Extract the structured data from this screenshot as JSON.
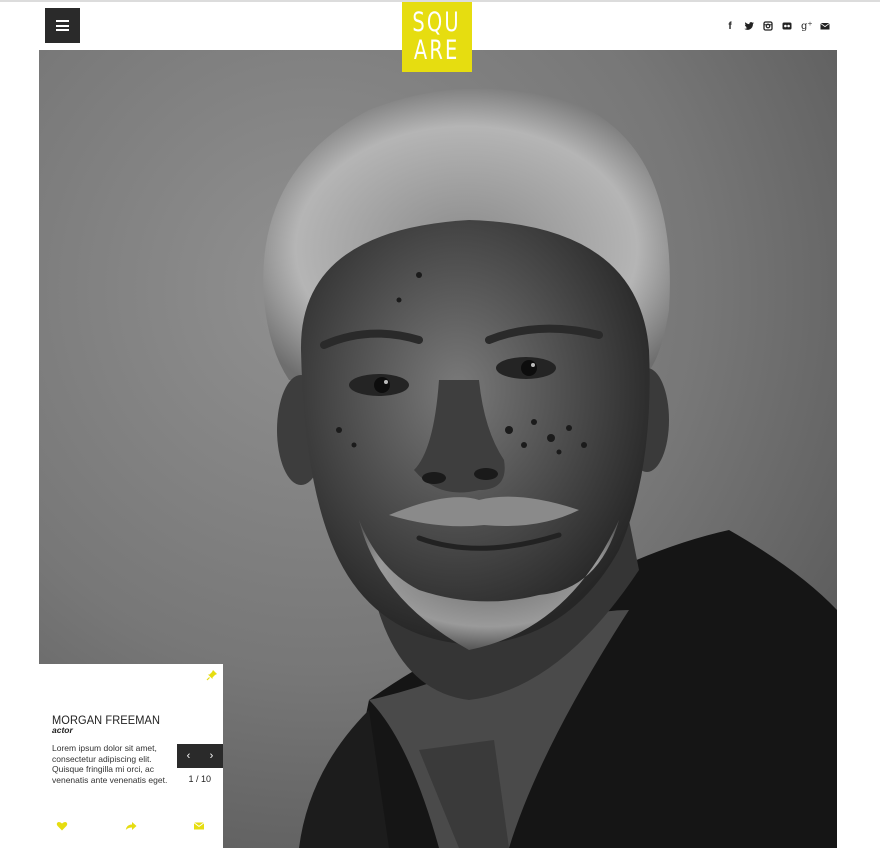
{
  "header": {
    "logo_line1": "SQU",
    "logo_line2": "ARE",
    "menu_icon": "hamburger-menu-icon",
    "social": [
      {
        "icon": "facebook-icon",
        "glyph": "f"
      },
      {
        "icon": "twitter-icon",
        "glyph": "🐦"
      },
      {
        "icon": "instagram-icon",
        "glyph": "◎"
      },
      {
        "icon": "flickr-icon",
        "glyph": "◉"
      },
      {
        "icon": "google-plus-icon",
        "glyph": "g⁺"
      },
      {
        "icon": "email-icon",
        "glyph": "✉"
      }
    ]
  },
  "colors": {
    "accent": "#e6dd10",
    "dark": "#2a2a2a"
  },
  "hero": {
    "image": "black-and-white portrait photograph"
  },
  "info_card": {
    "name": "MORGAN FREEMAN",
    "role": "actor",
    "description": "Lorem ipsum dolor sit amet, consectetur adipiscing elit. Quisque fringilla mi orci, ac venenatis ante venenatis eget.",
    "prev_glyph": "‹",
    "next_glyph": "›",
    "counter": "1 / 10",
    "pin_icon": "pin-icon",
    "actions": [
      "heart-icon",
      "share-icon",
      "email-icon"
    ]
  }
}
